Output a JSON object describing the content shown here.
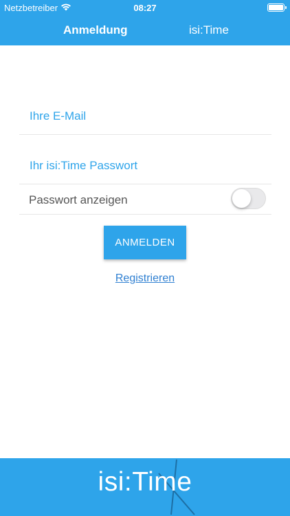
{
  "status_bar": {
    "carrier": "Netzbetreiber",
    "time": "08:27",
    "wifi_icon": "wifi-icon",
    "battery_icon": "battery-icon",
    "battery_level": 1.0
  },
  "nav": {
    "tab_login": "Anmeldung",
    "tab_time": "isi:Time"
  },
  "form": {
    "email_placeholder": "Ihre E-Mail",
    "email_value": "",
    "password_placeholder": "Ihr isi:Time Passwort",
    "password_value": "",
    "show_password_label": "Passwort anzeigen",
    "show_password_on": false,
    "login_button": "ANMELDEN",
    "register_link": "Registrieren"
  },
  "footer": {
    "logo_text": "isi:Time"
  },
  "colors": {
    "accent": "#2ea4ea",
    "link": "#2e7fd1",
    "label": "#555555",
    "mark": "#1d6fa5"
  }
}
